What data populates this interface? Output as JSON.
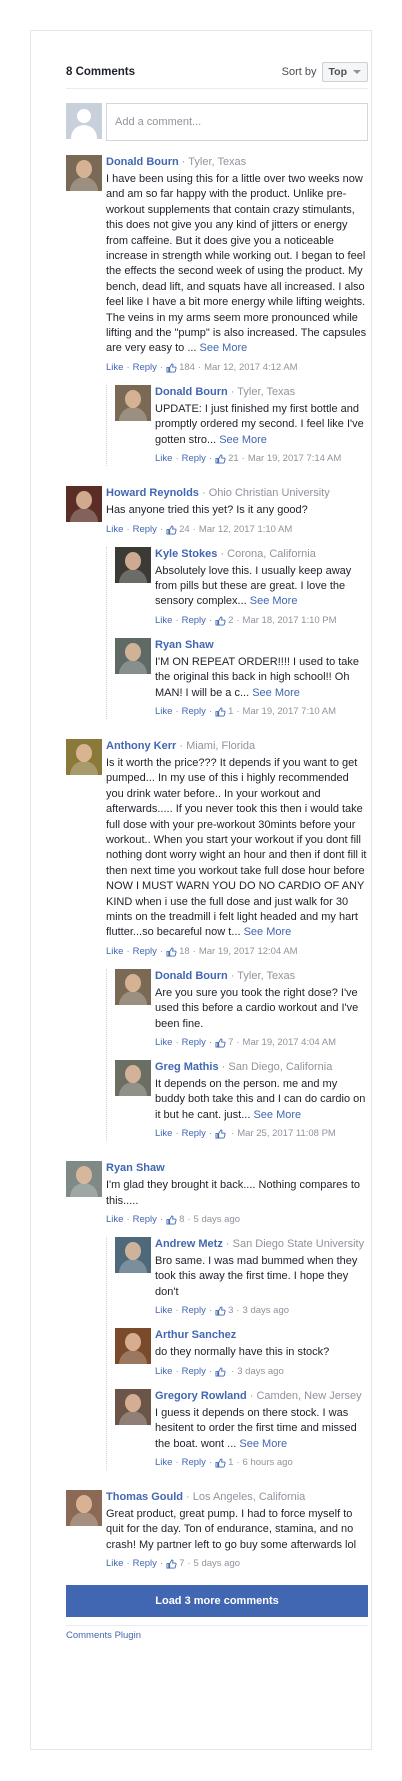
{
  "header": {
    "count_label": "8 Comments",
    "sort_label": "Sort by",
    "sort_value": "Top"
  },
  "composer": {
    "placeholder": "Add a comment..."
  },
  "actions": {
    "like": "Like",
    "reply": "Reply"
  },
  "comments": [
    {
      "author": "Donald Bourn",
      "location": "Tyler, Texas",
      "text": "I have been using this for a little over two weeks now and am so far happy with the product. Unlike pre-workout supplements that contain crazy stimulants, this does not give you any kind of jitters or energy from caffeine. But it does give you a noticeable increase in strength while working out. I began to feel the effects the second week of using the product. My bench, dead lift, and squats have all increased. I also feel like I have a bit more energy while lifting weights. The veins in my arms seem more pronounced while lifting and the \"pump\" is also increased. The capsules are very easy to ...",
      "see_more": "See More",
      "likes": "184",
      "time": "Mar 12, 2017 4:12 AM",
      "avatar_color": "#7a6a55",
      "replies": [
        {
          "author": "Donald Bourn",
          "location": "Tyler, Texas",
          "text": "UPDATE: I just finished my first bottle and promptly ordered my second. I feel like I've gotten stro...",
          "see_more": "See More",
          "likes": "21",
          "time": "Mar 19, 2017 7:14 AM",
          "avatar_color": "#7a6a55"
        }
      ]
    },
    {
      "author": "Howard Reynolds",
      "location": "Ohio Christian University",
      "text": "Has anyone tried this yet? Is it any good?",
      "see_more": "",
      "likes": "24",
      "time": "Mar 12, 2017 1:10 AM",
      "avatar_color": "#5a2e26",
      "replies": [
        {
          "author": "Kyle Stokes",
          "location": "Corona, California",
          "text": "Absolutely love this. I usually keep away from pills but these are great. I love the sensory complex...",
          "see_more": "See More",
          "likes": "2",
          "time": "Mar 18, 2017 1:10 PM",
          "avatar_color": "#3c3a36"
        },
        {
          "author": "Ryan Shaw",
          "location": "",
          "text": "I'M ON REPEAT ORDER!!!! I used to take the original this back in high school!! Oh MAN! I will be a c...",
          "see_more": "See More",
          "likes": "1",
          "time": "Mar 19, 2017 7:10 AM",
          "avatar_color": "#5f6a66"
        }
      ]
    },
    {
      "author": "Anthony Kerr",
      "location": "Miami, Florida",
      "text": "Is it worth the price??? It depends if you want to get pumped... In my use of this i highly recommended you drink water before.. In your workout and afterwards..... If you never took this then i would take full dose with your pre-workout 30mints before your workout.. When you start your workout if you dont fill nothing dont worry wight an hour and then if dont fill it then next time you workout take full dose hour before NOW I MUST WARN YOU DO NO CARDIO OF ANY KIND when i use the full dose and just walk for 30 mints on the treadmill i felt light headed and my hart flutter...so becareful now t...",
      "see_more": "See More",
      "likes": "18",
      "time": "Mar 19, 2017 12:04 AM",
      "avatar_color": "#8a7a3a",
      "replies": [
        {
          "author": "Donald Bourn",
          "location": "Tyler, Texas",
          "text": "Are you sure you took the right dose? I've used this before a cardio workout and I've been fine.",
          "see_more": "",
          "likes": "7",
          "time": "Mar 19, 2017 4:04 AM",
          "avatar_color": "#7a6a55"
        },
        {
          "author": "Greg Mathis",
          "location": "San Diego, California",
          "text": "It depends on the person. me and my buddy both take this and I can do cardio on it but he cant. just...",
          "see_more": "See More",
          "likes": "",
          "time": "Mar 25, 2017 11:08 PM",
          "avatar_color": "#6b6e63"
        }
      ]
    },
    {
      "author": "Ryan Shaw",
      "location": "",
      "text": "I'm glad they brought it back.... Nothing compares to this.....",
      "see_more": "",
      "likes": "8",
      "time": "5 days ago",
      "avatar_color": "#7f8a86",
      "replies": [
        {
          "author": "Andrew Metz",
          "location": "San Diego State University",
          "text": "Bro same. I was mad bummed when they took this away the first time. I hope they don't",
          "see_more": "",
          "likes": "3",
          "time": "3 days ago",
          "avatar_color": "#4e6a7a"
        },
        {
          "author": "Arthur Sanchez",
          "location": "",
          "text": "do they normally have this in stock?",
          "see_more": "",
          "likes": "",
          "time": "3 days ago",
          "avatar_color": "#7a4a2a"
        },
        {
          "author": "Gregory Rowland",
          "location": "Camden, New Jersey",
          "text": "I guess it depends on there stock. I was hesitent to order the first time and missed the boat. wont ...",
          "see_more": "See More",
          "likes": "1",
          "time": "6 hours ago",
          "avatar_color": "#6a5548"
        }
      ]
    },
    {
      "author": "Thomas Gould",
      "location": "Los Angeles, California",
      "text": "Great product, great pump. I had to force myself to quit for the day. Ton of endurance, stamina, and no crash! My partner left to go buy some afterwards lol",
      "see_more": "",
      "likes": "7",
      "time": "5 days ago",
      "avatar_color": "#8a6a55",
      "replies": []
    }
  ],
  "footer": {
    "load_more": "Load 3 more comments",
    "plugin": "Comments Plugin"
  },
  "colors": {
    "link": "#4267b2",
    "meta": "#90949c",
    "button": "#4267b2"
  }
}
